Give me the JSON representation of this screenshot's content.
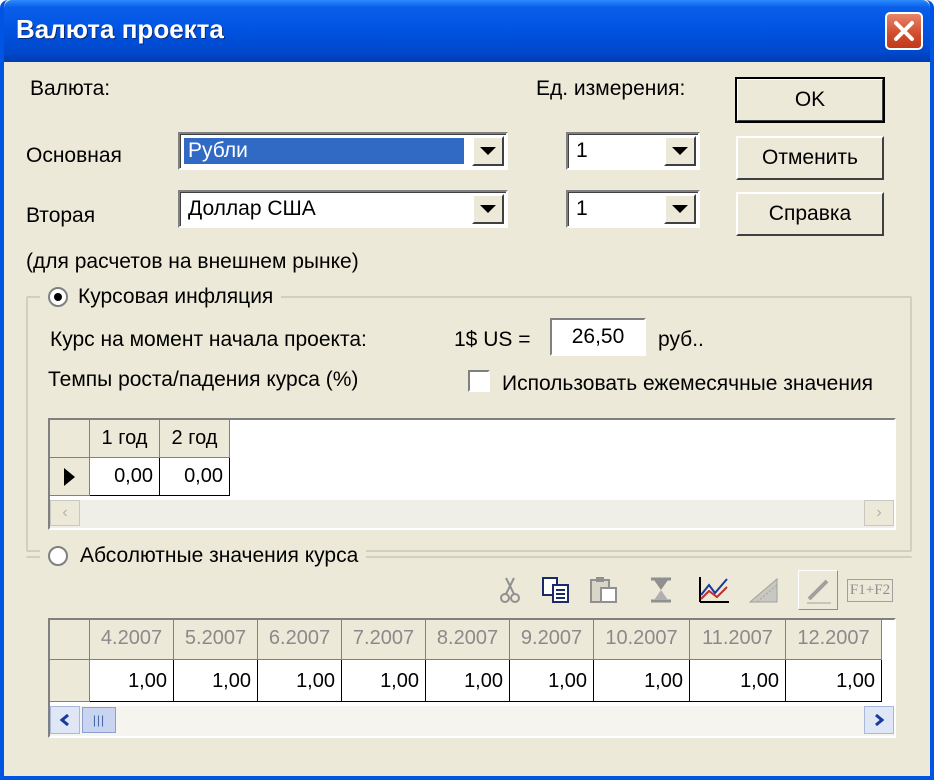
{
  "window": {
    "title": "Валюта проекта"
  },
  "currency": {
    "section_label": "Валюта:",
    "main_label": "Основная",
    "main_value": "Рубли",
    "second_label": "Вторая",
    "second_value": "Доллар США",
    "note": "(для расчетов на внешнем рынке)"
  },
  "units": {
    "label": "Ед. измерения:",
    "main_value": "1",
    "second_value": "1"
  },
  "buttons": {
    "ok": "OK",
    "cancel": "Отменить",
    "help": "Справка"
  },
  "rate_inflation": {
    "option_label": "Курсовая инфляция",
    "rate_label": "Курс на момент начала проекта:",
    "usd_label": "1$ US =",
    "rate_value": "26,50",
    "rate_unit": "руб..",
    "growth_label": "Темпы роста/падения курса (%)",
    "monthly_label": "Использовать ежемесячные значения",
    "table": {
      "headers": [
        "1 год",
        "2 год"
      ],
      "values": [
        "0,00",
        "0,00"
      ]
    }
  },
  "absolute": {
    "option_label": "Абсолютные значения курса",
    "table": {
      "headers": [
        "4.2007",
        "5.2007",
        "6.2007",
        "7.2007",
        "8.2007",
        "9.2007",
        "10.2007",
        "11.2007",
        "12.2007"
      ],
      "values": [
        "1,00",
        "1,00",
        "1,00",
        "1,00",
        "1,00",
        "1,00",
        "1,00",
        "1,00",
        "1,00"
      ]
    },
    "toolbar": [
      "scissors-icon",
      "copy-icon",
      "paste-icon",
      "hourglass-icon",
      "line-chart-icon",
      "area-chart-icon",
      "pencil-icon",
      "formula-icon"
    ],
    "toolbar_formula_text": "F1+F2"
  }
}
